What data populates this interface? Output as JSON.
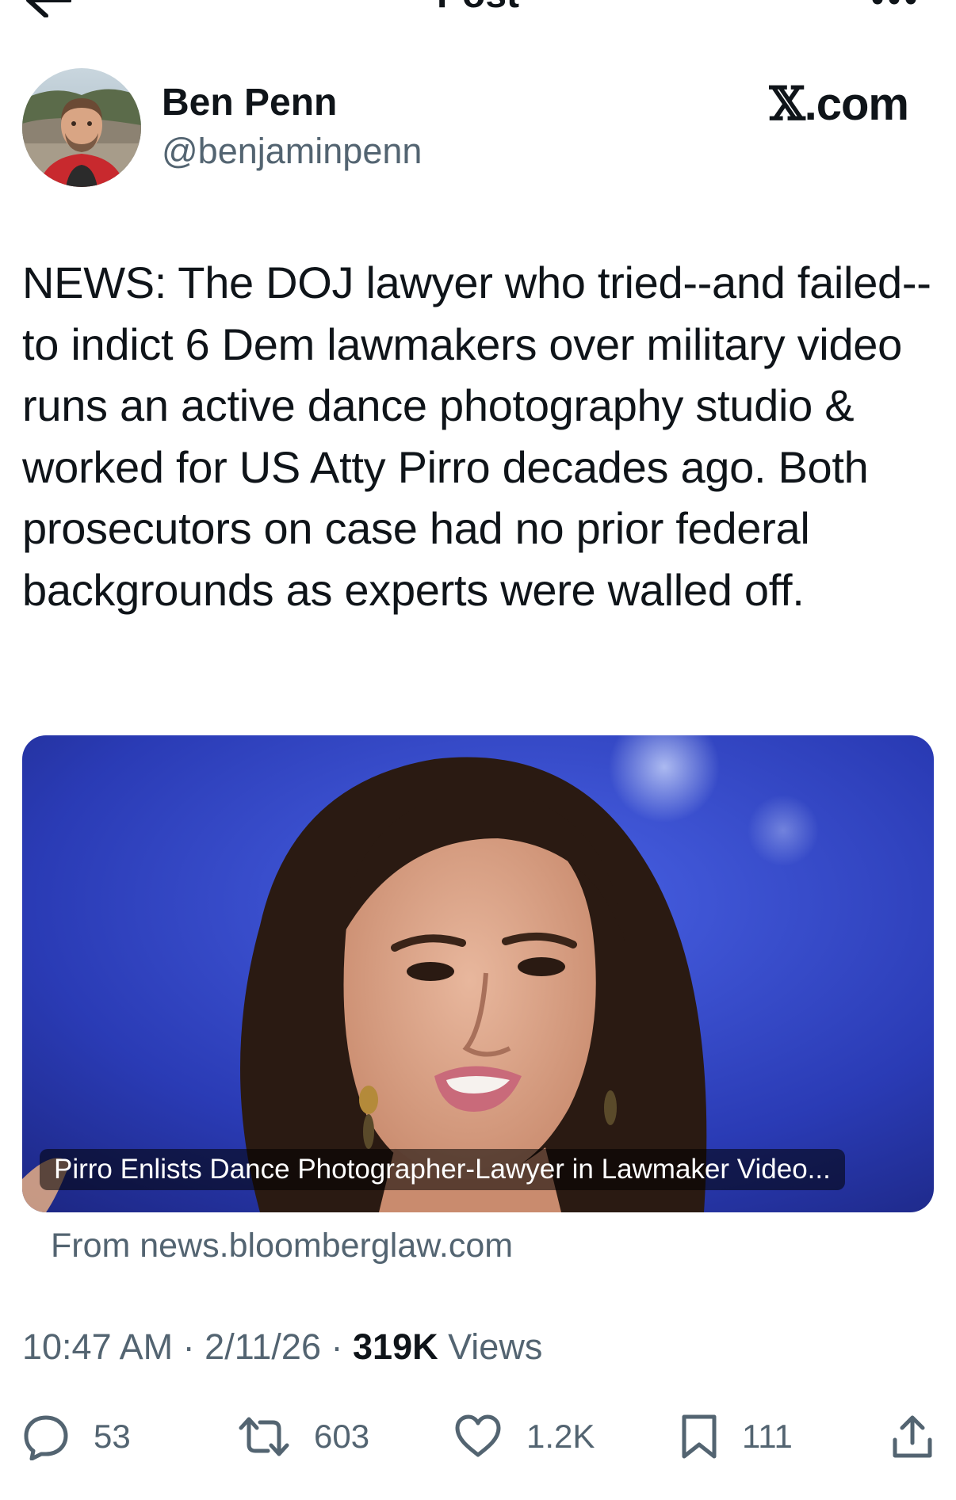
{
  "header": {
    "title": "Post"
  },
  "author": {
    "name": "Ben Penn",
    "handle": "@benjaminpenn"
  },
  "brand": {
    "logo_text": ".com"
  },
  "post": {
    "text": "NEWS: The DOJ lawyer who tried--and failed--to indict 6 Dem lawmakers over military video runs an active dance photography studio & worked for US Atty Pirro decades ago. Both prosecutors on case had no prior federal backgrounds as experts were walled off."
  },
  "card": {
    "caption": "Pirro Enlists Dance Photographer-Lawyer in Lawmaker Video...",
    "source": "From news.bloomberglaw.com"
  },
  "meta": {
    "time": "10:47 AM",
    "separator": "·",
    "date": "2/11/26",
    "views_count": "319K",
    "views_label": "Views"
  },
  "actions": {
    "replies": "53",
    "reposts": "603",
    "likes": "1.2K",
    "bookmarks": "111"
  },
  "colors": {
    "text": "#0f1419",
    "secondary": "#536471",
    "card_background": "#2a3bb5"
  },
  "icons": [
    "back-arrow-icon",
    "more-icon",
    "x-logo-icon",
    "reply-icon",
    "repost-icon",
    "like-icon",
    "bookmark-icon",
    "share-icon"
  ]
}
